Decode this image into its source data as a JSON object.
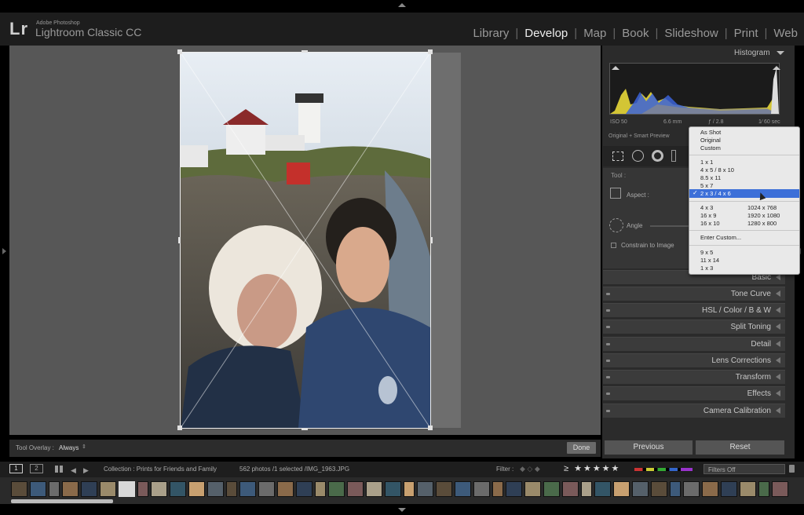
{
  "app": {
    "logo": "Lr",
    "vendor": "Adobe Photoshop",
    "name": "Lightroom Classic CC"
  },
  "modules": [
    {
      "label": "Library",
      "active": false
    },
    {
      "label": "Develop",
      "active": true
    },
    {
      "label": "Map",
      "active": false
    },
    {
      "label": "Book",
      "active": false
    },
    {
      "label": "Slideshow",
      "active": false
    },
    {
      "label": "Print",
      "active": false
    },
    {
      "label": "Web",
      "active": false
    }
  ],
  "histogram": {
    "title": "Histogram",
    "iso": "ISO 50",
    "focal": "6.6 mm",
    "aperture": "ƒ / 2.8",
    "shutter": "1⁄ 60 sec",
    "preview": "Original + Smart Preview"
  },
  "crop": {
    "tool_label": "Tool :",
    "aspect_label": "Aspect :",
    "angle_label": "Angle",
    "constrain_label": "Constrain to Image"
  },
  "aspect_menu": {
    "items_a": [
      "As Shot",
      "Original",
      "Custom"
    ],
    "items_b": [
      "1 x 1",
      "4 x 5  /  8 x 10",
      "8.5 x 11",
      "5 x 7"
    ],
    "selected": "2 x 3  /  4 x 6",
    "items_c_left": [
      "4 x 3",
      "16 x 9",
      "16 x 10"
    ],
    "items_c_right": [
      "1024 x 768",
      "1920 x 1080",
      "1280 x 800"
    ],
    "custom": "Enter Custom...",
    "items_d": [
      "9 x 5",
      "11 x 14",
      "1 x 3"
    ]
  },
  "panels": [
    "Basic",
    "Tone Curve",
    "HSL  /  Color  /  B & W",
    "Split Toning",
    "Detail",
    "Lens Corrections",
    "Transform",
    "Effects",
    "Camera Calibration"
  ],
  "toolbar": {
    "overlay_label": "Tool Overlay :",
    "overlay_value": "Always",
    "done": "Done"
  },
  "buttons": {
    "previous": "Previous",
    "reset": "Reset"
  },
  "filmstrip": {
    "screen1": "1",
    "screen2": "2",
    "collection": "Collection : Prints for Friends and Family",
    "count": "562 photos /1 selected /IMG_1963.JPG",
    "filter_label": "Filter :",
    "filters_off": "Filters Off"
  },
  "colors": {
    "accent_selection": "#3c6fd8",
    "histogram_yellow": "#e8d838",
    "histogram_blue": "#3a62d8"
  }
}
